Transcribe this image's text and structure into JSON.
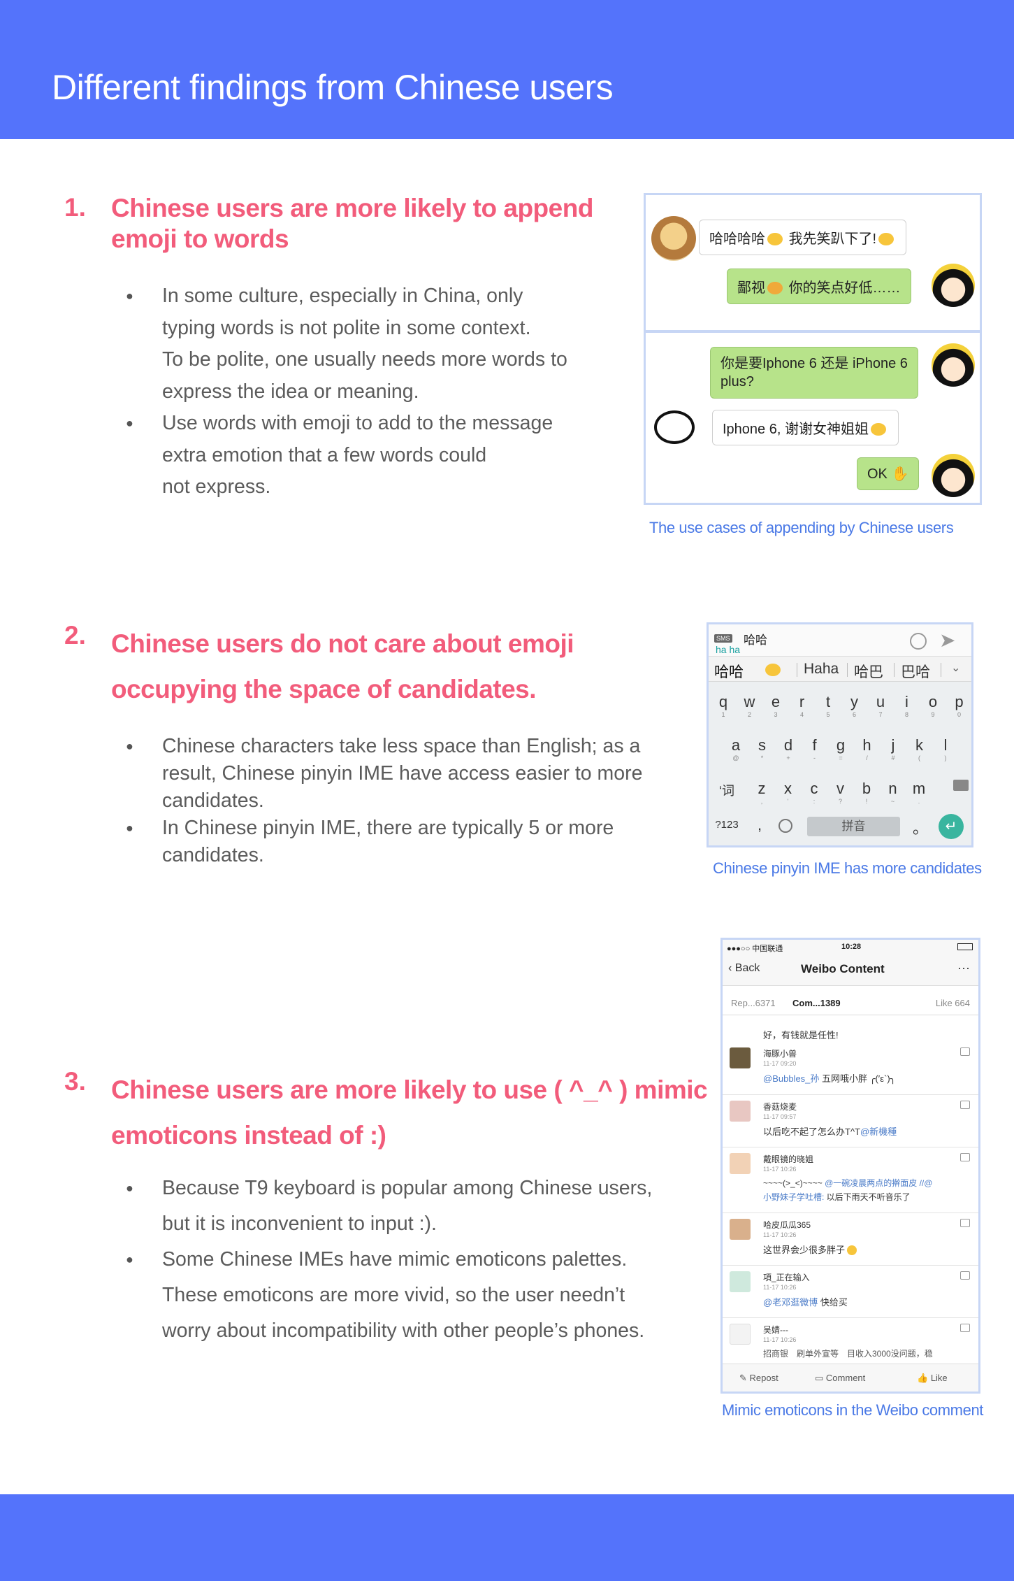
{
  "header": {
    "title": "Different findings from Chinese users"
  },
  "sections": [
    {
      "number": "1.",
      "title_lines": [
        "Chinese users are more likely to append",
        "emoji to words"
      ],
      "bullet_lines": [
        [
          "In some culture, especially in China, only",
          "typing words is not polite in some context.",
          "To be polite, one usually needs more words to",
          "express the idea or meaning."
        ],
        [
          "Use words with emoji to add to the message",
          "extra emotion that a few words could",
          "not express."
        ]
      ],
      "caption": "The use cases of appending by Chinese users"
    },
    {
      "number": "2.",
      "title_lines": [
        "Chinese users do not care about emoji",
        "occupying the space of candidates."
      ],
      "bullet_lines": [
        [
          "Chinese characters take less space than English; as a",
          "result, Chinese pinyin IME have access easier to more",
          "candidates."
        ],
        [
          "In Chinese pinyin IME, there are typically 5 or more",
          "candidates."
        ]
      ],
      "caption": "Chinese pinyin IME has more candidates"
    },
    {
      "number": "3.",
      "title_lines": [
        "Chinese users are more likely to use ( ^_^ ) mimic",
        "emoticons instead of :)"
      ],
      "bullet_lines": [
        [
          "Because T9 keyboard is popular among Chinese users,",
          "but it is inconvenient to input :)."
        ],
        [
          "Some Chinese IMEs have mimic emoticons palettes.",
          "These emoticons are more vivid, so the user needn’t",
          "worry about incompatibility with other people’s phones."
        ]
      ],
      "caption": "Mimic emoticons in the Weibo comment"
    }
  ],
  "chat": {
    "messages": [
      {
        "text_before": "哈哈哈哈",
        "text_after": "我先笑趴下了!"
      },
      {
        "text_before": "鄙视",
        "text_after": "你的笑点好低……"
      },
      {
        "line1": "你是要Iphone 6 还是 iPhone 6",
        "line2": "plus?"
      },
      {
        "text": "Iphone 6, 谢谢女神姐姐"
      },
      {
        "text": "OK"
      }
    ]
  },
  "keyboard": {
    "typed": "哈哈",
    "pinyin": "ha ha",
    "sms_badge": "SMS",
    "candidates": [
      "哈哈",
      "Haha",
      "哈巴",
      "巴哈"
    ],
    "row1": [
      "q",
      "w",
      "e",
      "r",
      "t",
      "y",
      "u",
      "i",
      "o",
      "p"
    ],
    "row1_sub": [
      "1",
      "2",
      "3",
      "4",
      "5",
      "6",
      "7",
      "8",
      "9",
      "0"
    ],
    "row2": [
      "a",
      "s",
      "d",
      "f",
      "g",
      "h",
      "j",
      "k",
      "l"
    ],
    "row2_sub": [
      "@",
      "*",
      "+",
      "-",
      "=",
      "/",
      "#",
      "(",
      ")"
    ],
    "row3": [
      "z",
      "x",
      "c",
      "v",
      "b",
      "n",
      "m"
    ],
    "row3_sub": [
      ",",
      "'",
      ":",
      "?",
      "!",
      "~",
      "."
    ],
    "shift_key": "‘词",
    "num_key": "?123",
    "comma_key": ",",
    "space_key": "拼音",
    "period_key": "。"
  },
  "weibo": {
    "carrier": "●●●○○ 中国联通",
    "time": "10:28",
    "back": "Back",
    "title": "Weibo Content",
    "more": "···",
    "tab_repost": "Rep...6371",
    "tab_comment": "Com...1389",
    "tab_like": "Like 664",
    "top_text": "好，有钱就是任性!",
    "comments": [
      {
        "name": "海豚小兽",
        "time": "11-17 09:20",
        "link": "@Bubbles_孙",
        "text": " 五网哦小胖 ╭(′ε`)╮"
      },
      {
        "name": "香菇烧麦",
        "time": "11-17 09:57",
        "text": "以后吃不起了怎么办T^T",
        "link": "@新機種"
      },
      {
        "name": "戴眼镜的晓姐",
        "time": "11-17 10:26",
        "text": "~~~~(>_<)~~~~ ",
        "link": "@一碗凌晨两点的擀面皮 //@",
        "line2_link": "小野妹子学吐槽:",
        "line2_text": " 以后下雨天不听音乐了"
      },
      {
        "name": "哈皮瓜瓜365",
        "time": "11-17 10:26",
        "text": "这世界会少很多胖子"
      },
      {
        "name": "項_正在输入",
        "time": "11-17 10:26",
        "link": "@老邓逛微博",
        "text": " 快给买"
      },
      {
        "name": "吴婧---",
        "time": "11-17 10:26",
        "text": "招商银　刷单外宣等　目收入3000没问题，稳"
      }
    ],
    "repost": "Repost",
    "comment": "Comment",
    "like": "Like"
  }
}
